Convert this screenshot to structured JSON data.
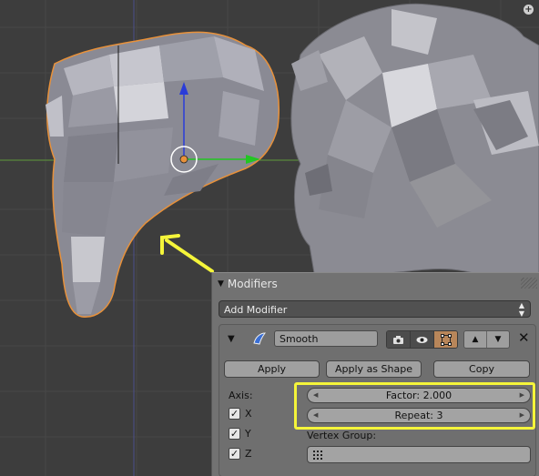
{
  "panel": {
    "title": "Modifiers",
    "add_modifier_label": "Add Modifier"
  },
  "modifier": {
    "name": "Smooth",
    "icon": "smooth-modifier-icon",
    "buttons": {
      "apply": "Apply",
      "apply_shape": "Apply as Shape",
      "copy": "Copy"
    },
    "axis_label": "Axis:",
    "axes": [
      {
        "label": "X",
        "checked": true
      },
      {
        "label": "Y",
        "checked": true
      },
      {
        "label": "Z",
        "checked": true
      }
    ],
    "factor_text": "Factor: 2.000",
    "repeat_text": "Repeat: 3",
    "vertex_group_label": "Vertex Group:",
    "vertex_group_value": ""
  },
  "colors": {
    "viewport_bg": "#3d3d3d",
    "selection_outline": "#e8913a",
    "annotation_yellow": "#f5f53a",
    "mesh_gray": "#8a8a94"
  }
}
